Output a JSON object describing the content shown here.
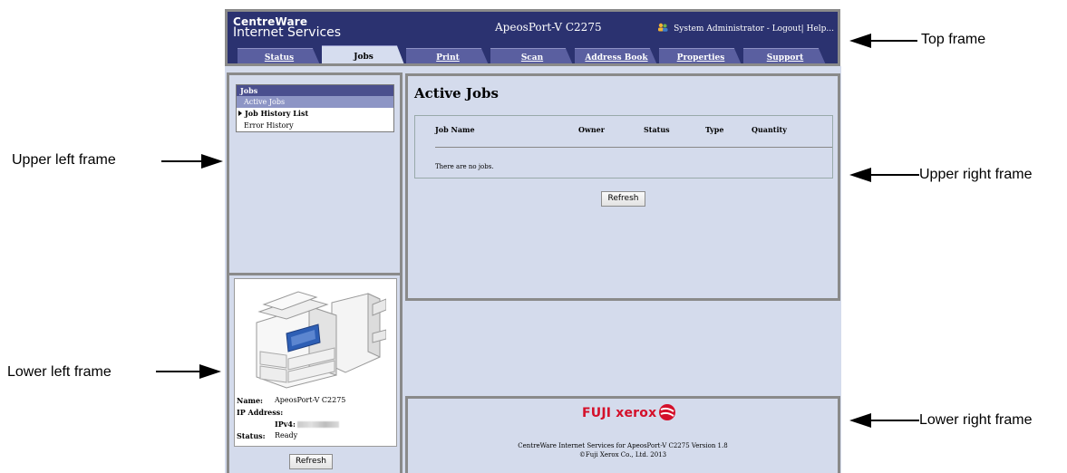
{
  "header": {
    "brand_line1": "CentreWare",
    "brand_line2": "Internet Services",
    "device_title": "ApeosPort-V C2275",
    "user_label": "System Administrator",
    "logout_label": "- Logout|",
    "help_label": "Help..."
  },
  "tabs": [
    {
      "label": "Status"
    },
    {
      "label": "Jobs"
    },
    {
      "label": "Print"
    },
    {
      "label": "Scan"
    },
    {
      "label": "Address Book"
    },
    {
      "label": "Properties"
    },
    {
      "label": "Support"
    }
  ],
  "active_tab": "Jobs",
  "nav": {
    "header": "Jobs",
    "items": [
      {
        "label": "Active Jobs"
      },
      {
        "label": "Job History List"
      },
      {
        "label": "Error History"
      }
    ]
  },
  "device": {
    "name_label": "Name:",
    "name_value": "ApeosPort-V C2275",
    "ip_label": "IP Address:",
    "ipv4_label": "IPv4:",
    "status_label": "Status:",
    "status_value": "Ready",
    "refresh_label": "Refresh"
  },
  "main": {
    "title": "Active Jobs",
    "columns": [
      "Job Name",
      "Owner",
      "Status",
      "Type",
      "Quantity"
    ],
    "empty_message": "There are no jobs.",
    "refresh_label": "Refresh"
  },
  "footer": {
    "logo_text": "FUJI xerox",
    "line1": "CentreWare Internet Services for ApeosPort-V C2275 Version 1.8",
    "line2": "©Fuji Xerox Co., Ltd. 2013"
  },
  "annotations": {
    "top_frame": "Top frame",
    "upper_left_frame": "Upper left frame",
    "lower_left_frame": "Lower left frame",
    "upper_right_frame": "Upper right frame",
    "lower_right_frame": "Lower right frame"
  },
  "colors": {
    "header_bg": "#2b3270",
    "body_bg": "#d4dbec",
    "tab_bg": "#5a5fa0",
    "logo_red": "#d4102a"
  }
}
